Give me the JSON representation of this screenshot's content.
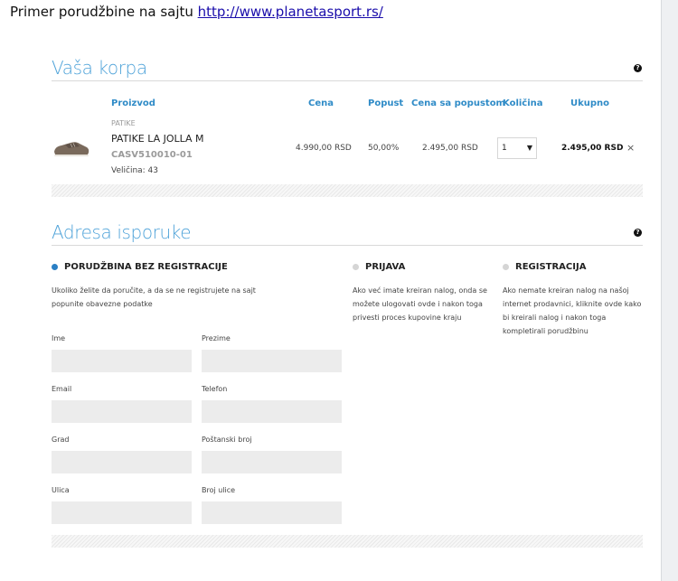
{
  "intro": {
    "text": "Primer porudžbine na sajtu ",
    "link": "http://www.planetasport.rs/"
  },
  "cart": {
    "title": "Vaša korpa",
    "columns": {
      "product": "Proizvod",
      "price": "Cena",
      "discount": "Popust",
      "discounted_price": "Cena sa popustom",
      "quantity": "Količina",
      "total": "Ukupno"
    },
    "item": {
      "category": "PATIKE",
      "name": "PATIKE LA JOLLA M",
      "sku": "CASV510010-01",
      "size": "Veličina: 43",
      "price": "4.990,00 RSD",
      "discount": "50,00%",
      "discounted_price": "2.495,00 RSD",
      "quantity": "1",
      "total": "2.495,00 RSD",
      "remove": "×"
    }
  },
  "address": {
    "title": "Adresa isporuke",
    "options": [
      {
        "title": "PORUDŽBINA BEZ REGISTRACIJE",
        "desc": "Ukoliko želite da poručite, a da se ne registrujete na sajt popunite obavezne podatke",
        "selected": true
      },
      {
        "title": "PRIJAVA",
        "desc": "Ako već imate kreiran nalog, onda se možete ulogovati ovde i nakon toga privesti proces kupovine kraju",
        "selected": false
      },
      {
        "title": "REGISTRACIJA",
        "desc": "Ako nemate kreiran nalog na našoj internet prodavnici, kliknite ovde kako bi kreirali nalog i nakon toga kompletirali porudžbinu",
        "selected": false
      }
    ],
    "fields": {
      "ime": "Ime",
      "prezime": "Prezime",
      "email": "Email",
      "telefon": "Telefon",
      "grad": "Grad",
      "postanski": "Poštanski broj",
      "ulica": "Ulica",
      "broj": "Broj ulice"
    }
  },
  "icons": {
    "help": "help-icon",
    "remove": "close-icon",
    "dropdown": "chevron-down-icon"
  },
  "colors": {
    "accent": "#2f8bc7",
    "title": "#4fa3d9",
    "selected_dot": "#2a7fc4",
    "unselected_dot": "#d5d5d5"
  }
}
